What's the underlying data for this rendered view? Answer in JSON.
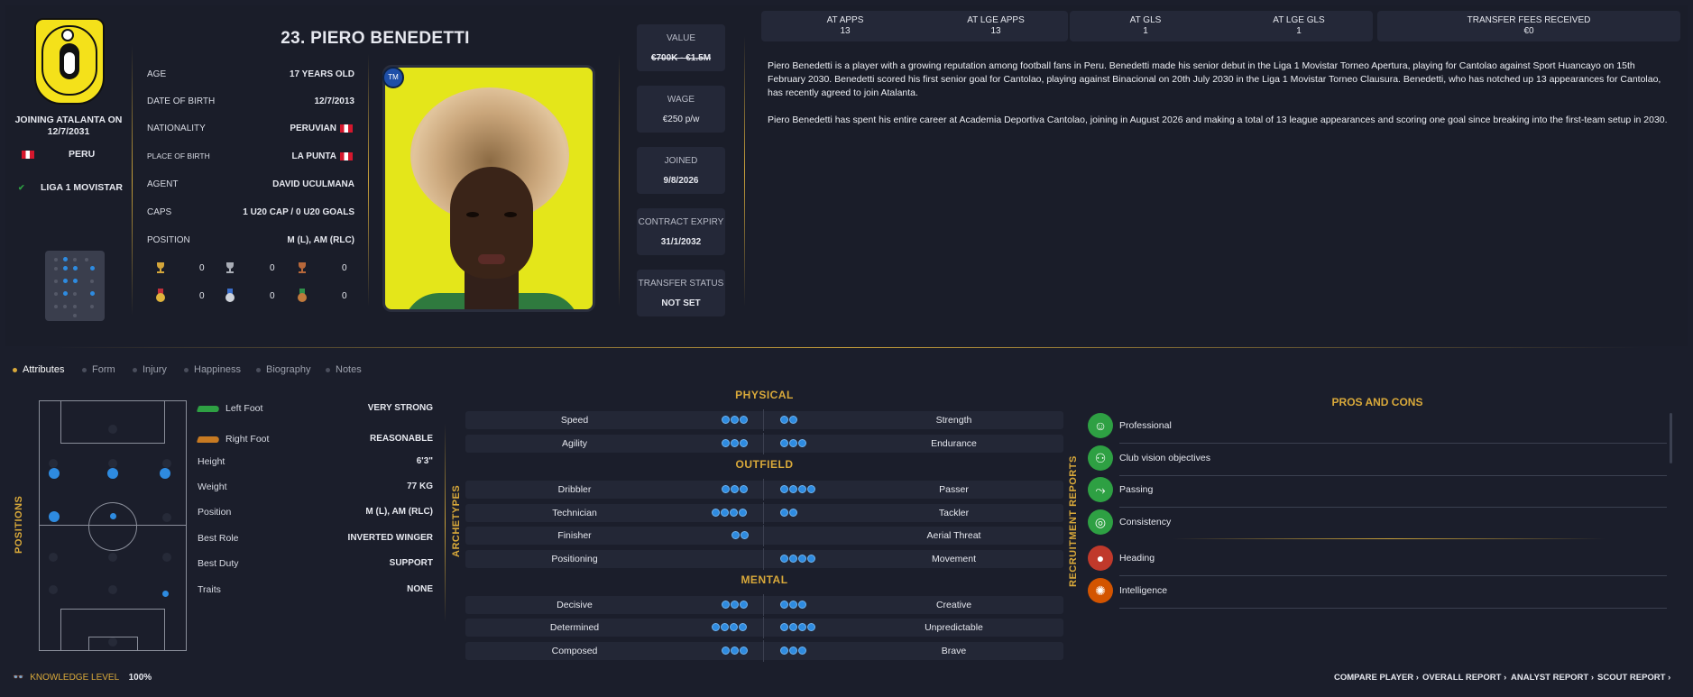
{
  "player": {
    "name": "23. PIERO BENEDETTI",
    "joining": "JOINING ATALANTA ON 12/7/2031",
    "country": "PERU",
    "league": "LIGA 1 MOVISTAR",
    "badge_text": "TM"
  },
  "info": [
    {
      "label": "AGE",
      "value": "17 YEARS OLD"
    },
    {
      "label": "DATE OF BIRTH",
      "value": "12/7/2013"
    },
    {
      "label": "NATIONALITY",
      "value": "PERUVIAN"
    },
    {
      "label": "PLACE OF BIRTH",
      "value": "LA PUNTA"
    },
    {
      "label": "AGENT",
      "value": "DAVID UCULMANA"
    },
    {
      "label": "CAPS",
      "value": "1 U20 CAP / 0 U20 GOALS"
    },
    {
      "label": "POSITION",
      "value": "M (L), AM (RLC)"
    }
  ],
  "trophies": [
    "0",
    "0",
    "0",
    "0",
    "0",
    "0"
  ],
  "stats": [
    {
      "title": "VALUE",
      "value": "€700K - €1.5M"
    },
    {
      "title": "WAGE",
      "value": "€250 p/w"
    },
    {
      "title": "JOINED",
      "value": "9/8/2026"
    },
    {
      "title": "CONTRACT EXPIRY",
      "value": "31/1/2032"
    },
    {
      "title": "TRANSFER STATUS",
      "value": "NOT SET"
    }
  ],
  "apps": [
    {
      "title": "AT APPS",
      "value": "13"
    },
    {
      "title": "AT LGE APPS",
      "value": "13"
    },
    {
      "title": "AT GLS",
      "value": "1"
    },
    {
      "title": "AT LGE GLS",
      "value": "1"
    },
    {
      "title": "TRANSFER FEES RECEIVED",
      "value": "€0"
    }
  ],
  "bio": [
    "Piero Benedetti is a player with a growing reputation among football fans in Peru. Benedetti made his senior debut in the Liga 1 Movistar Torneo Apertura, playing for Cantolao against Sport Huancayo on 15th February 2030. Benedetti scored his first senior goal for Cantolao, playing against Binacional on 20th July 2030 in the Liga 1 Movistar Torneo Clausura. Benedetti, who has notched up 13 appearances for Cantolao, has recently agreed to join Atalanta.",
    "Piero Benedetti has spent his entire career at Academia Deportiva Cantolao, joining in August 2026 and making a total of 13 league appearances and scoring one goal since breaking into the first-team setup in 2030."
  ],
  "tabs": [
    "Attributes",
    "Form",
    "Injury",
    "Happiness",
    "Biography",
    "Notes"
  ],
  "positions_label": "POSITIONS",
  "profile": [
    {
      "label": "Left Foot",
      "value": "VERY STRONG"
    },
    {
      "label": "Right Foot",
      "value": "REASONABLE"
    },
    {
      "label": "Height",
      "value": "6'3\""
    },
    {
      "label": "Weight",
      "value": "77 KG"
    },
    {
      "label": "Position",
      "value": "M (L), AM (RLC)"
    },
    {
      "label": "Best Role",
      "value": "INVERTED WINGER"
    },
    {
      "label": "Best Duty",
      "value": "SUPPORT"
    },
    {
      "label": "Traits",
      "value": "NONE"
    }
  ],
  "archetypes_label": "ARCHETYPES",
  "sections": {
    "physical": "PHYSICAL",
    "outfield": "OUTFIELD",
    "mental": "MENTAL"
  },
  "attributes": [
    {
      "left": "Speed",
      "ldots": 3,
      "right": "Strength",
      "rdots": 2
    },
    {
      "left": "Agility",
      "ldots": 3,
      "right": "Endurance",
      "rdots": 3
    },
    {
      "left": "Dribbler",
      "ldots": 3,
      "right": "Passer",
      "rdots": 4
    },
    {
      "left": "Technician",
      "ldots": 4,
      "right": "Tackler",
      "rdots": 2
    },
    {
      "left": "Finisher",
      "ldots": 2,
      "right": "Aerial Threat",
      "rdots": 0
    },
    {
      "left": "Positioning",
      "ldots": 0,
      "right": "Movement",
      "rdots": 4
    },
    {
      "left": "Decisive",
      "ldots": 3,
      "right": "Creative",
      "rdots": 3
    },
    {
      "left": "Determined",
      "ldots": 4,
      "right": "Unpredictable",
      "rdots": 4
    },
    {
      "left": "Composed",
      "ldots": 3,
      "right": "Brave",
      "rdots": 3
    }
  ],
  "recruitment_label": "RECRUITMENT REPORTS",
  "pros_cons_title": "PROS AND CONS",
  "pros": [
    {
      "label": "Professional",
      "icon": "head-icon",
      "color": "#2ea043"
    },
    {
      "label": "Club vision objectives",
      "icon": "group-icon",
      "color": "#2ea043"
    },
    {
      "label": "Passing",
      "icon": "passing-icon",
      "color": "#2ea043"
    },
    {
      "label": "Consistency",
      "icon": "target-icon",
      "color": "#2ea043"
    }
  ],
  "cons": [
    {
      "label": "Heading",
      "icon": "heading-icon",
      "color": "#c0392b"
    },
    {
      "label": "Intelligence",
      "icon": "brain-icon",
      "color": "#d35400"
    }
  ],
  "footer": {
    "knowledge_label": "KNOWLEDGE LEVEL",
    "knowledge_value": "100%",
    "links": [
      "COMPARE PLAYER ›",
      "OVERALL REPORT ›",
      "ANALYST REPORT ›",
      "SCOUT REPORT ›"
    ]
  },
  "colors": {
    "accent": "#d9a93a",
    "dot": "#2e8be0",
    "bg": "#1b1e2b"
  }
}
